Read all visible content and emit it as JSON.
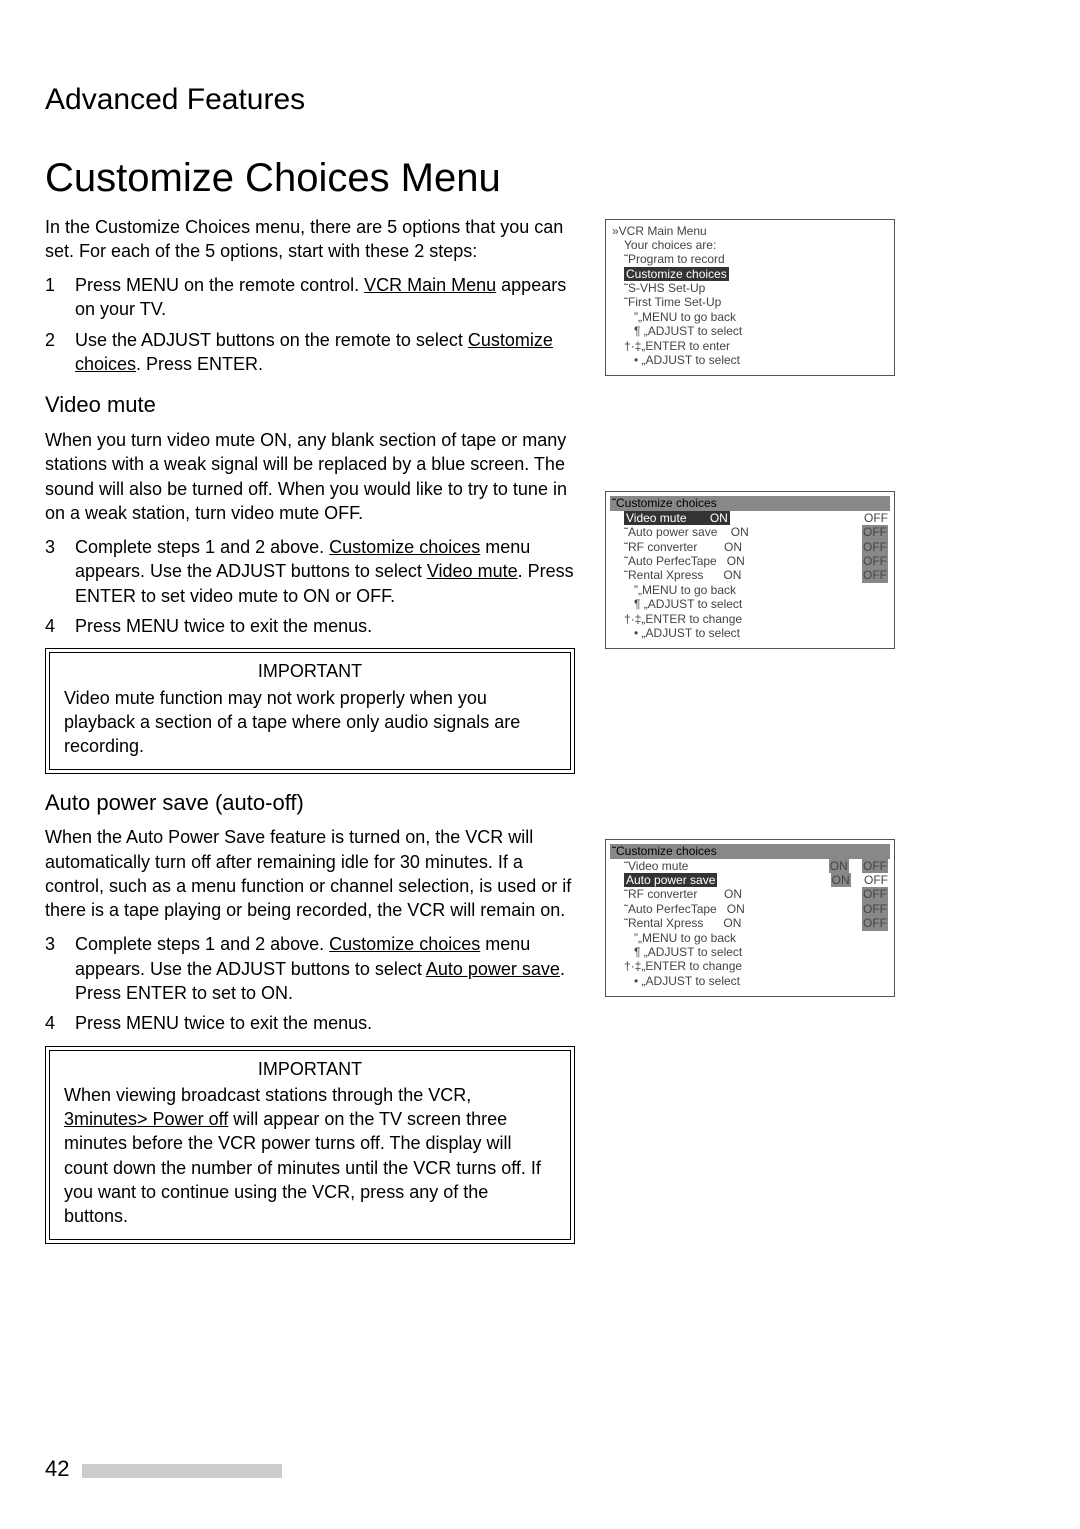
{
  "header": {
    "section": "Advanced Features",
    "title": "Customize Choices Menu"
  },
  "intro": {
    "p1": "In the Customize Choices menu, there are 5 options that you can set.  For each of the 5 options, start with these 2 steps:",
    "step1_pre": "Press MENU on the remote control.  ",
    "step1_u": "VCR Main Menu",
    "step1_post": " appears on your TV.",
    "step2_pre": "Use the ADJUST buttons on the remote to select ",
    "step2_u": "Customize choices",
    "step2_post": ".  Press ENTER."
  },
  "video_mute": {
    "heading": "Video mute",
    "para": "When you turn video mute ON, any blank section of tape or many stations with a weak signal will be replaced by a blue screen.  The sound will also be turned off.  When you would like to try to tune in on a weak station, turn video mute OFF.",
    "step3_pre": "Complete steps 1 and 2 above.  ",
    "step3_u1": "Customize choices",
    "step3_mid": " menu appears.  Use the ADJUST buttons to select ",
    "step3_u2": "Video mute",
    "step3_post": ". Press ENTER to set video mute to ON or OFF.",
    "step4": "Press MENU twice to exit the menus.",
    "important_label": "IMPORTANT",
    "important_body": "Video mute function may not work properly when you playback a section of a tape where only audio signals are recording."
  },
  "auto_power": {
    "heading": "Auto power save (auto-off)",
    "para": "When the Auto Power Save feature is turned on, the VCR will automatically turn off after remaining idle for 30 minutes.  If a control, such as a menu function or channel selection, is used or if there is a tape playing or being recorded, the VCR will remain on.",
    "step3_pre": "Complete steps 1 and 2 above.  ",
    "step3_u1": "Customize choices",
    "step3_mid": " menu appears.  Use the ADJUST buttons to select ",
    "step3_u2": "Auto power save",
    "step3_post": ". Press ENTER to set to ON.",
    "step4": "Press MENU twice to exit the menus.",
    "important_label": "IMPORTANT",
    "important_pre": "When viewing broadcast stations through the VCR, ",
    "important_u": "3minutes> Power off",
    "important_post": " will appear on the TV screen three minutes before the VCR power turns off.  The display will count down the number of minutes until the VCR turns off.  If you want to continue using the VCR, press any of the buttons."
  },
  "osd1": {
    "title": "»VCR Main Menu",
    "sub": "Your choices are:",
    "items": [
      "˜Program to record",
      "Customize choices",
      "˜S-VHS Set-Up",
      "˜First Time Set-Up"
    ],
    "hl_index": 1,
    "help": [
      "”„MENU to go back",
      "¶ „ADJUST to select",
      "†·‡„ENTER  to enter",
      "• „ADJUST  to select"
    ]
  },
  "osd2": {
    "title": "˜Customize choices",
    "rows": [
      {
        "label": "Video mute",
        "on": "ON",
        "off": "OFF",
        "hl": true
      },
      {
        "label": "˜Auto power save",
        "on": "ON",
        "off": "OFF"
      },
      {
        "label": "˜RF converter",
        "on": "ON",
        "off": "OFF"
      },
      {
        "label": "˜Auto PerfecTape",
        "on": "ON",
        "off": "OFF"
      },
      {
        "label": "˜Rental Xpress",
        "on": "ON",
        "off": "OFF"
      }
    ],
    "help": [
      "”„MENU to go back",
      "¶ „ADJUST to select",
      "†·‡„ENTER  to change",
      "• „ADJUST  to select"
    ]
  },
  "osd3": {
    "title": "˜Customize choices",
    "rows": [
      {
        "label": "˜Video mute",
        "on": "ON",
        "off": "OFF",
        "off_hl": true
      },
      {
        "label": "Auto power save",
        "on": "ON",
        "off": "OFF",
        "hl": true
      },
      {
        "label": "˜RF converter",
        "on": "ON",
        "off": "OFF"
      },
      {
        "label": "˜Auto PerfecTape",
        "on": "ON",
        "off": "OFF"
      },
      {
        "label": "˜Rental Xpress",
        "on": "ON",
        "off": "OFF"
      }
    ],
    "help": [
      "”„MENU to go back",
      "¶ „ADJUST to select",
      "†·‡„ENTER  to change",
      "• „ADJUST  to select"
    ]
  },
  "page_number": "42"
}
